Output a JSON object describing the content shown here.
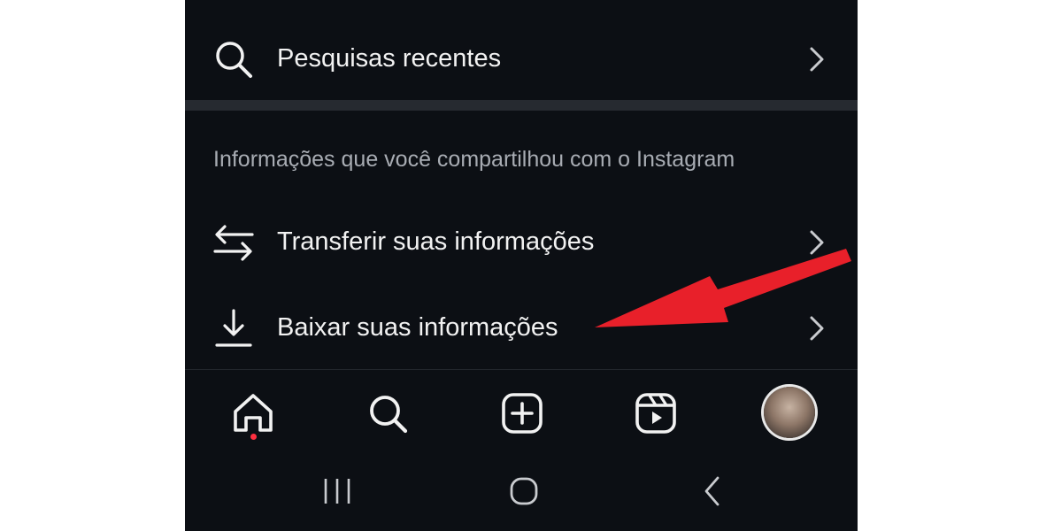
{
  "menu": {
    "recent_searches_label": "Pesquisas recentes",
    "section_header": "Informações que você compartilhou com o Instagram",
    "transfer_label": "Transferir suas informações",
    "download_label": "Baixar suas informações"
  },
  "bottom_nav": {
    "items": [
      "home-icon",
      "search-icon",
      "create-icon",
      "reels-icon",
      "profile-avatar"
    ],
    "home_has_notification": true
  },
  "system_nav": {
    "items": [
      "recent-apps-icon",
      "home-circle-icon",
      "back-icon"
    ]
  },
  "annotation": {
    "arrow_color": "#e8202a",
    "points_to": "download_label"
  },
  "colors": {
    "background": "#0c0f14",
    "text": "#f2f2f2",
    "secondary_text": "#a8acb3",
    "notification_dot": "#ff3040"
  }
}
